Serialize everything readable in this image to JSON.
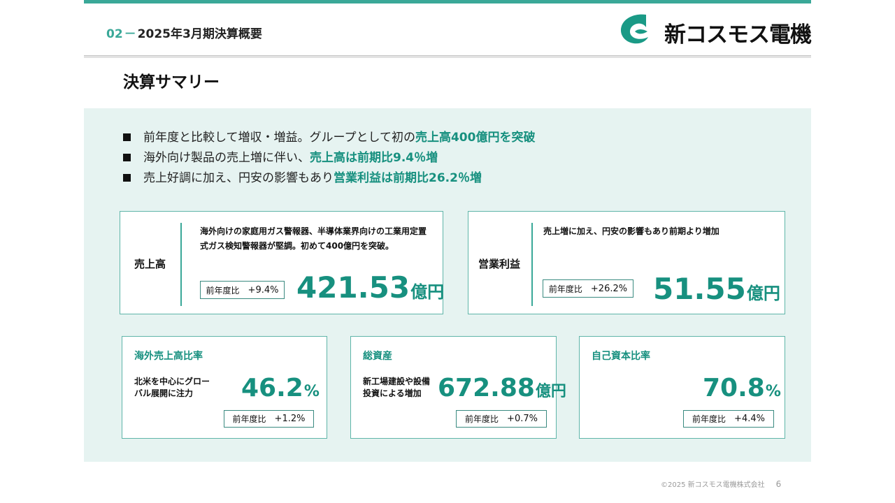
{
  "header": {
    "section_number": "02",
    "section_dash": "－",
    "section_title": "2025年3月期決算概要",
    "logo_text": "新コスモス電機",
    "logo_mark_color": "#1a9a86"
  },
  "page_title": "決算サマリー",
  "bullets": [
    {
      "text": "前年度と比較して増収・増益。グループとして初の",
      "highlight": "売上高400億円を突破"
    },
    {
      "text": "海外向け製品の売上増に伴い、",
      "highlight": "売上高は前期比9.4％増"
    },
    {
      "text": "売上好調に加え、円安の影響もあり",
      "highlight": "営業利益は前期比26.2％増"
    }
  ],
  "sales": {
    "label": "売上高",
    "description": "海外向けの家庭用ガス警報器、半導体業界向けの工業用定置式ガス検知警報器が堅調。初めて400億円を突破。",
    "yoy_label": "前年度比",
    "yoy_value": "+9.4%",
    "value": "421.53",
    "unit": "億円"
  },
  "operating_profit": {
    "label": "営業利益",
    "description": "売上増に加え、円安の影響もあり前期より増加",
    "yoy_label": "前年度比",
    "yoy_value": "+26.2%",
    "value": "51.55",
    "unit": "億円"
  },
  "overseas_ratio": {
    "title": "海外売上高比率",
    "description": "北米を中心にグローバル展開に注力",
    "value": "46.2",
    "unit": "%",
    "yoy_label": "前年度比",
    "yoy_value": "+1.2%"
  },
  "total_assets": {
    "title": "総資産",
    "description": "新工場建設や設備投資による増加",
    "value": "672.88",
    "unit": "億円",
    "yoy_label": "前年度比",
    "yoy_value": "+0.7%"
  },
  "equity_ratio": {
    "title": "自己資本比率",
    "value": "70.8",
    "unit": "%",
    "yoy_label": "前年度比",
    "yoy_value": "+4.4%"
  },
  "footer": {
    "copyright": "©2025 新コスモス電機株式会社",
    "page_number": "6"
  },
  "colors": {
    "accent": "#17907f",
    "panel_bg": "#e6f3f1",
    "top_bar": "#3aa898"
  }
}
